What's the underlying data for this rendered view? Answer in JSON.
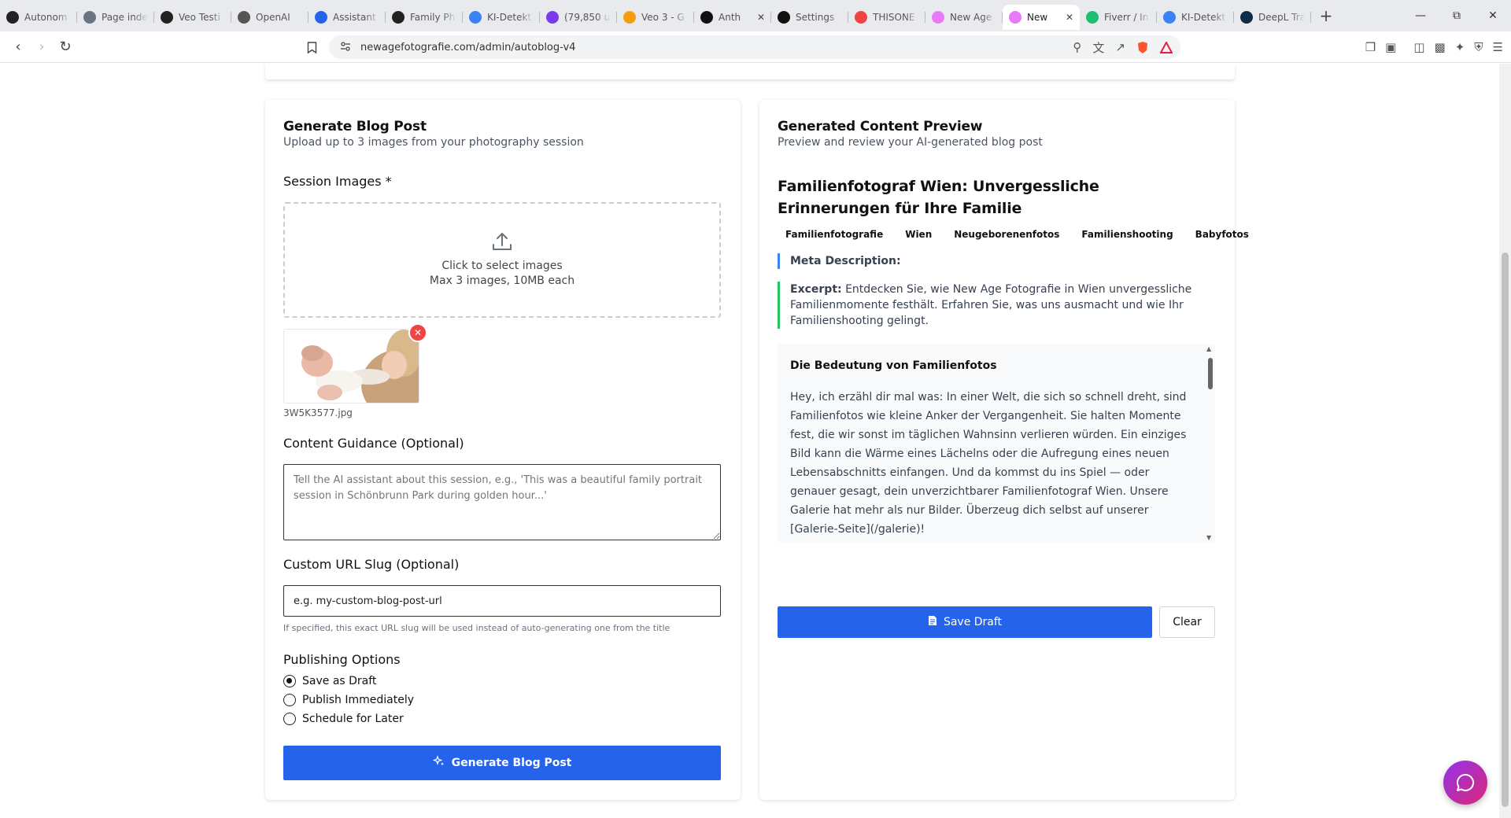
{
  "browser": {
    "tabs": [
      {
        "title": "Autonom",
        "icon": "openai-icon",
        "color": "#222222",
        "active": false
      },
      {
        "title": "Page inde",
        "icon": "page-index-icon",
        "color": "#6b7280",
        "active": false
      },
      {
        "title": "Veo Testi",
        "icon": "openai-icon",
        "color": "#222222",
        "active": false
      },
      {
        "title": "OpenAI",
        "icon": "openai-icon",
        "color": "#555555",
        "active": false
      },
      {
        "title": "Assistant",
        "icon": "assistant-icon",
        "color": "#2563eb",
        "active": false
      },
      {
        "title": "Family Ph",
        "icon": "openai-icon",
        "color": "#222222",
        "active": false
      },
      {
        "title": "KI-Detekt",
        "icon": "ki-detect-icon",
        "color": "#3b82f6",
        "active": false
      },
      {
        "title": "(79,850 u",
        "icon": "mail-icon",
        "color": "#7c3aed",
        "active": false
      },
      {
        "title": "Veo 3 - G",
        "icon": "drive-icon",
        "color": "#f59e0b",
        "active": false
      },
      {
        "title": "Anth",
        "icon": "anthropic-icon",
        "color": "#111111",
        "active": false,
        "closable": true
      },
      {
        "title": "Settings",
        "icon": "settings-icon",
        "color": "#111111",
        "active": false
      },
      {
        "title": "THISONE",
        "icon": "thisone-icon",
        "color": "#ef4444",
        "active": false
      },
      {
        "title": "New Age",
        "icon": "newage-icon",
        "color": "#e879f9",
        "active": false
      },
      {
        "title": "New",
        "icon": "newage-icon",
        "color": "#e879f9",
        "active": true,
        "closable": true
      },
      {
        "title": "Fiverr / In",
        "icon": "fiverr-icon",
        "color": "#1dbf73",
        "active": false
      },
      {
        "title": "KI-Detekt",
        "icon": "ki-detect-icon",
        "color": "#3b82f6",
        "active": false
      },
      {
        "title": "DeepL Tra",
        "icon": "deepl-icon",
        "color": "#0f2b46",
        "active": false
      }
    ],
    "url": "newagefotografie.com/admin/autoblog-v4"
  },
  "form": {
    "title": "Generate Blog Post",
    "subtitle": "Upload up to 3 images from your photography session",
    "images_label": "Session Images *",
    "dropzone_line1": "Click to select images",
    "dropzone_line2": "Max 3 images, 10MB each",
    "uploaded_file": "3W5K3577.jpg",
    "guidance_label": "Content Guidance (Optional)",
    "guidance_placeholder": "Tell the AI assistant about this session, e.g., 'This was a beautiful family portrait session in Schönbrunn Park during golden hour...'",
    "slug_label": "Custom URL Slug (Optional)",
    "slug_placeholder": "e.g. my-custom-blog-post-url",
    "slug_hint": "If specified, this exact URL slug will be used instead of auto-generating one from the title",
    "publishing_label": "Publishing Options",
    "options": [
      {
        "label": "Save as Draft",
        "checked": true
      },
      {
        "label": "Publish Immediately",
        "checked": false
      },
      {
        "label": "Schedule for Later",
        "checked": false
      }
    ],
    "generate_label": "Generate Blog Post"
  },
  "preview": {
    "title": "Generated Content Preview",
    "subtitle": "Preview and review your AI-generated blog post",
    "post_title": "Familienfotograf Wien: Unvergessliche Erinnerungen für Ihre Familie",
    "tags": [
      "Familienfotografie",
      "Wien",
      "Neugeborenenfotos",
      "Familienshooting",
      "Babyfotos"
    ],
    "meta_label": "Meta Description:",
    "excerpt_label": "Excerpt:",
    "excerpt_text": "Entdecken Sie, wie New Age Fotografie in Wien unvergessliche Familienmomente festhält. Erfahren Sie, was uns ausmacht und wie Ihr Familienshooting gelingt.",
    "content_heading": "Die Bedeutung von Familienfotos",
    "content_paragraph": "Hey, ich erzähl dir mal was: In einer Welt, die sich so schnell dreht, sind Familienfotos wie kleine Anker der Vergangenheit. Sie halten Momente fest, die wir sonst im täglichen Wahnsinn verlieren würden. Ein einziges Bild kann die Wärme eines Lächelns oder die Aufregung eines neuen Lebensabschnitts einfangen. Und da kommst du ins Spiel — oder genauer gesagt, dein unverzichtbarer Familienfotograf Wien. Unsere Galerie hat mehr als nur Bilder. Überzeug dich selbst auf unserer [Galerie-Seite](/galerie)!",
    "save_label": "Save Draft",
    "clear_label": "Clear"
  },
  "colors": {
    "primary": "#2563eb",
    "meta_accent": "#3b82f6",
    "excerpt_accent": "#22c55e",
    "remove": "#ef4444"
  }
}
